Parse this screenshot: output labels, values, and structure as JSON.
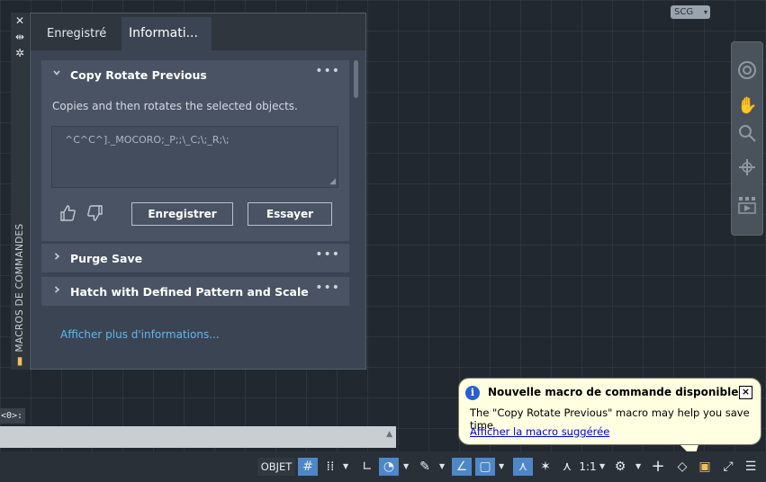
{
  "viewport": {
    "coord_system_label": "SCG"
  },
  "palette": {
    "title": "MACROS DE COMMANDES",
    "tabs": [
      {
        "label": "Enregistré"
      },
      {
        "label": "Informati..."
      }
    ],
    "active_tab": "Informati...",
    "cards": [
      {
        "title": "Copy Rotate Previous",
        "expanded": true,
        "description": "Copies and then rotates the selected objects.",
        "macro": "^C^C^]._MOCORO;_P;;\\_C;\\;_R;\\;",
        "record_label": "Enregistrer",
        "try_label": "Essayer"
      },
      {
        "title": "Purge Save",
        "expanded": false
      },
      {
        "title": "Hatch with Defined Pattern and Scale",
        "expanded": false
      }
    ],
    "more_link": "Afficher plus d'informations...",
    "menu_glyph": "•••"
  },
  "command_line": {
    "prompt": "<0>:"
  },
  "notification": {
    "title": "Nouvelle macro de commande disponible",
    "message": "The \"Copy Rotate Previous\" macro may help you save time",
    "link": "Afficher la macro suggérée",
    "close_glyph": "×"
  },
  "status_bar": {
    "model_label": "OBJET",
    "scale_label": "1:1",
    "toggles_on": [
      "grid",
      "polar",
      "ortho-dynamic",
      "selection-cycle",
      "annotation"
    ]
  },
  "colors": {
    "accent_on": "#4d87c7",
    "link_blue": "#62b7f0",
    "tooltip_bg": "#ffffe1"
  }
}
